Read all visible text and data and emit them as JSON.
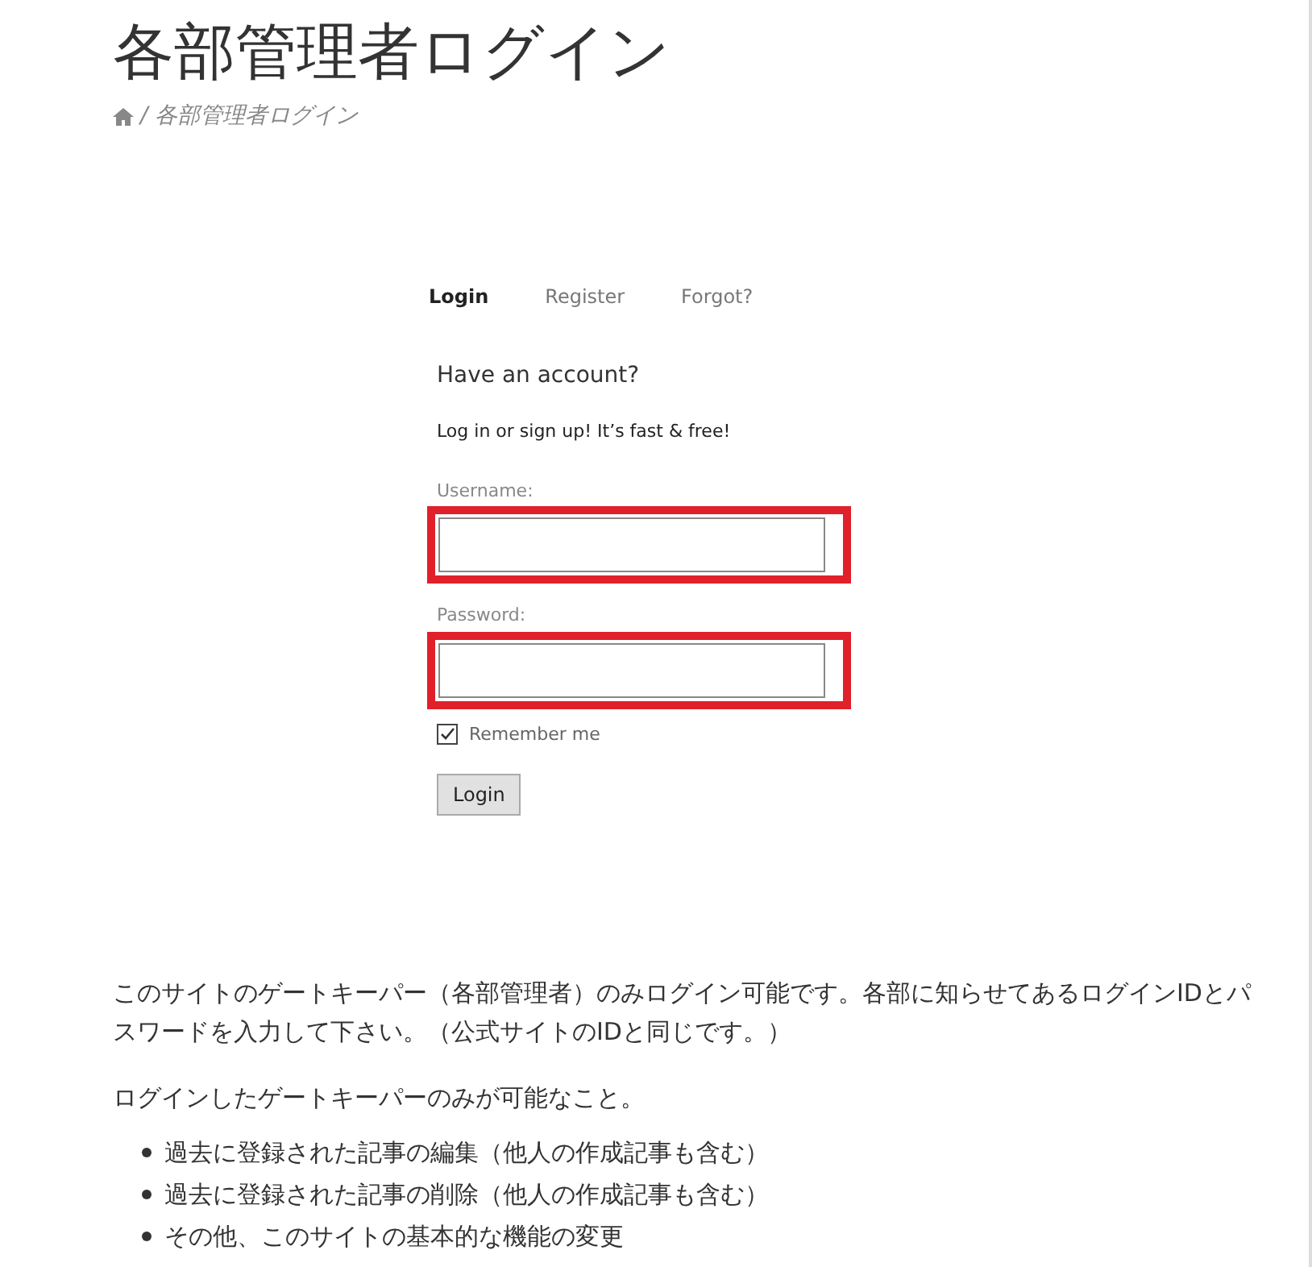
{
  "page": {
    "title": "各部管理者ログイン"
  },
  "breadcrumb": {
    "separator": "/",
    "current": "各部管理者ログイン"
  },
  "tabs": [
    {
      "label": "Login",
      "selected": true
    },
    {
      "label": "Register",
      "selected": false
    },
    {
      "label": "Forgot?",
      "selected": false
    }
  ],
  "form": {
    "heading": "Have an account?",
    "subtitle": "Log in or sign up! It’s fast & free!",
    "fields": [
      {
        "label": "Username:",
        "highlighted": true
      },
      {
        "label": "Password:",
        "highlighted": true
      }
    ],
    "remember": {
      "label": "Remember me",
      "checked": true
    },
    "submit": "Login"
  },
  "notice": "このサイトのゲートキーパー（各部管理者）のみログイン可能です。各部に知らせてあるログインIDとパスワードを入力して下さい。（公式サイトのIDと同じです。）",
  "list_heading": "ログインしたゲートキーパーのみが可能なこと。",
  "list": [
    "過去に登録された記事の編集（他人の作成記事も含む）",
    "過去に登録された記事の削除（他人の作成記事も含む）",
    "その他、このサイトの基本的な機能の変更"
  ]
}
